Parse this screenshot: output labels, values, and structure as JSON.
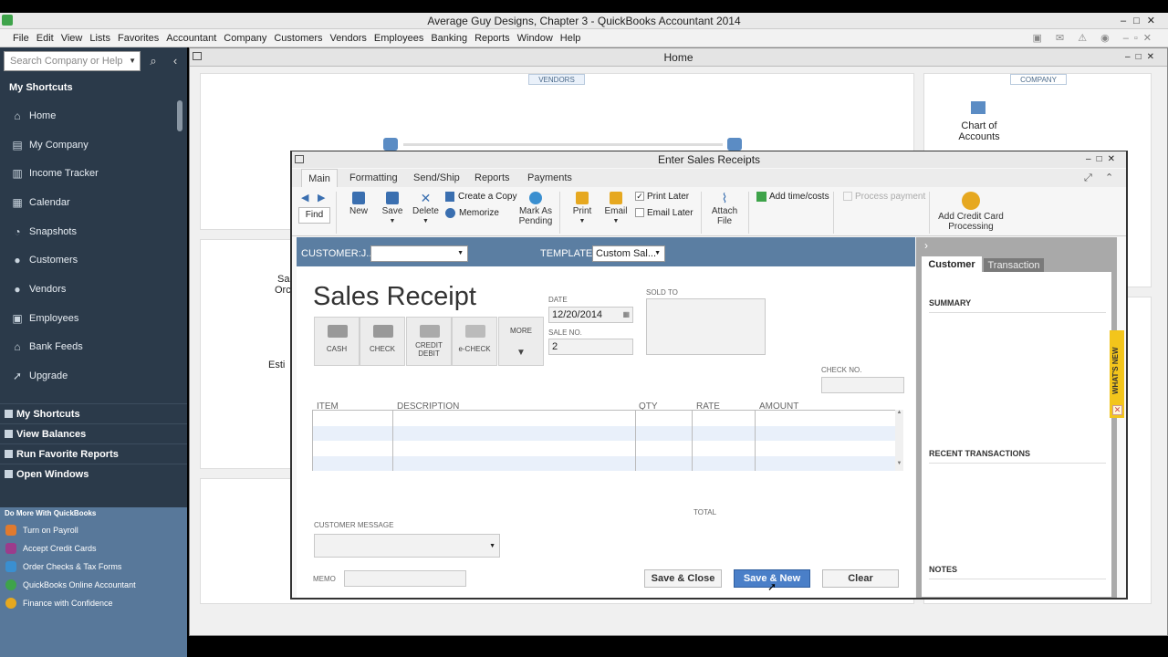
{
  "window": {
    "title": "Average Guy Designs, Chapter 3  - QuickBooks Accountant 2014"
  },
  "menu": [
    "File",
    "Edit",
    "View",
    "Lists",
    "Favorites",
    "Accountant",
    "Company",
    "Customers",
    "Vendors",
    "Employees",
    "Banking",
    "Reports",
    "Window",
    "Help"
  ],
  "search": {
    "placeholder": "Search Company or Help"
  },
  "sidebar": {
    "header": "My Shortcuts",
    "items": [
      {
        "label": "Home",
        "icon": "home-icon"
      },
      {
        "label": "My Company",
        "icon": "company-icon"
      },
      {
        "label": "Income Tracker",
        "icon": "tracker-icon"
      },
      {
        "label": "Calendar",
        "icon": "calendar-icon"
      },
      {
        "label": "Snapshots",
        "icon": "snapshot-icon"
      },
      {
        "label": "Customers",
        "icon": "customers-icon"
      },
      {
        "label": "Vendors",
        "icon": "vendors-icon"
      },
      {
        "label": "Employees",
        "icon": "employees-icon"
      },
      {
        "label": "Bank Feeds",
        "icon": "bank-icon"
      },
      {
        "label": "Upgrade",
        "icon": "upgrade-icon"
      }
    ],
    "nav": [
      "My Shortcuts",
      "View Balances",
      "Run Favorite Reports",
      "Open Windows"
    ],
    "domore_title": "Do More With QuickBooks",
    "domore": [
      {
        "label": "Turn on Payroll",
        "color": "#e07a2e"
      },
      {
        "label": "Accept Credit Cards",
        "color": "#9b3c8c"
      },
      {
        "label": "Order Checks & Tax Forms",
        "color": "#3a8fd0"
      },
      {
        "label": "QuickBooks Online Accountant",
        "color": "#3ea34a"
      },
      {
        "label": "Finance with Confidence",
        "color": "#e6a820"
      }
    ]
  },
  "home": {
    "title": "Home",
    "vendors_tag": "VENDORS",
    "company_tag": "COMPANY",
    "chart_of_accounts_1": "Chart of",
    "chart_of_accounts_2": "Accounts",
    "partial_sa": "Sa",
    "partial_orc": "Orc",
    "partial_esti": "Esti"
  },
  "dialog": {
    "title": "Enter Sales Receipts",
    "tabs": [
      "Main",
      "Formatting",
      "Send/Ship",
      "Reports",
      "Payments"
    ],
    "ribbon": {
      "find": "Find",
      "new": "New",
      "save": "Save",
      "delete": "Delete",
      "create_copy": "Create a Copy",
      "memorize": "Memorize",
      "mark_pending_1": "Mark As",
      "mark_pending_2": "Pending",
      "print": "Print",
      "email": "Email",
      "print_later": "Print Later",
      "email_later": "Email Later",
      "attach_1": "Attach",
      "attach_2": "File",
      "add_time": "Add time/costs",
      "process_payment": "Process payment",
      "add_cc_1": "Add Credit Card",
      "add_cc_2": "Processing"
    },
    "customer_label": "CUSTOMER:J...",
    "template_label": "TEMPLATE",
    "template_value": "Custom Sal...",
    "form_title": "Sales Receipt",
    "date_label": "DATE",
    "date_value": "12/20/2014",
    "sale_no_label": "SALE NO.",
    "sale_no_value": "2",
    "sold_to_label": "SOLD TO",
    "check_no_label": "CHECK NO.",
    "payments": [
      "CASH",
      "CHECK",
      "CREDIT DEBIT",
      "e-CHECK"
    ],
    "more": "MORE",
    "columns": [
      "ITEM",
      "DESCRIPTION",
      "QTY",
      "RATE",
      "AMOUNT"
    ],
    "total_label": "TOTAL",
    "customer_message_label": "CUSTOMER MESSAGE",
    "memo_label": "MEMO",
    "buttons": {
      "save_close": "Save & Close",
      "save_new": "Save & New",
      "clear": "Clear"
    }
  },
  "right_panel": {
    "tabs": [
      "Customer",
      "Transaction"
    ],
    "summary": "SUMMARY",
    "recent": "RECENT TRANSACTIONS",
    "notes": "NOTES",
    "whats_new": "WHAT'S NEW"
  }
}
